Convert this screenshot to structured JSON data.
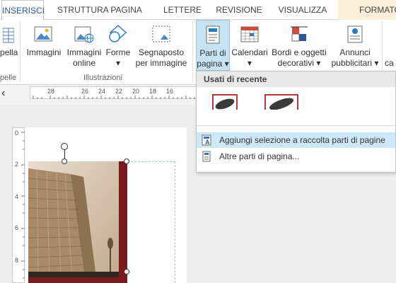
{
  "tabs": [
    {
      "label": "INSERISCI",
      "active": true
    },
    {
      "label": "STRUTTURA PAGINA"
    },
    {
      "label": "LETTERE"
    },
    {
      "label": "REVISIONE"
    },
    {
      "label": "VISUALIZZA"
    },
    {
      "label": "FORMATO"
    }
  ],
  "ribbon": {
    "left_cut_label": "pella",
    "left_cut_group": "pelle",
    "buttons": {
      "immagini": "Immagini",
      "immagini_online_1": "Immagini",
      "immagini_online_2": "online",
      "forme_1": "Forme",
      "forme_2": "▾",
      "segnaposto_1": "Segnaposto",
      "segnaposto_2": "per immagine",
      "parti_1": "Parti di",
      "parti_2": "pagina ▾",
      "calendari_1": "Calendari",
      "calendari_2": "▾",
      "bordi_1": "Bordi e oggetti",
      "bordi_2": "decorativi ▾",
      "annunci_1": "Annunci",
      "annunci_2": "pubblicitari ▾",
      "right_cut": "ca"
    },
    "group_illustrazioni": "Illustrazioni"
  },
  "ruler": {
    "collapse_glyph": "‹",
    "h_labels": [
      "28",
      "26",
      "24",
      "22",
      "20",
      "18",
      "16"
    ],
    "v_labels": [
      "0",
      "2",
      "4",
      "6",
      "8"
    ]
  },
  "dropdown": {
    "header": "Usati di recente",
    "items": [
      {
        "label": "Aggiungi selezione a raccolta parti di pagine",
        "underline": "g"
      },
      {
        "label": "Altre parti di pagina...",
        "underline": "A"
      }
    ]
  },
  "colors": {
    "accent": "#2b579a",
    "selected_button": "#c5e3f0",
    "menu_highlight": "#cde8f6",
    "formato_tab": "#fcefd7",
    "photo_frame": "#7a1a1a"
  }
}
